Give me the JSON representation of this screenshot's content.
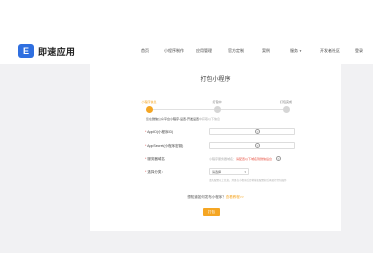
{
  "header": {
    "logo_mark": "E",
    "logo_text": "即速应用",
    "nav": [
      {
        "label": "首页",
        "left": 0
      },
      {
        "label": "小程序制作",
        "left": 0
      },
      {
        "label": "应用管理",
        "left": 0
      },
      {
        "label": "官方定制",
        "left": 0
      },
      {
        "label": "案例",
        "left": 0
      },
      {
        "label": "服务",
        "left": 0,
        "has_dropdown": true
      },
      {
        "label": "开发者社区",
        "left": 0
      },
      {
        "label": "登录",
        "left": 0
      }
    ]
  },
  "card": {
    "title": "打包小程序",
    "steps": [
      {
        "label": "小程序信息",
        "active": true
      },
      {
        "label": "打包中",
        "active": false
      },
      {
        "label": "打包完成",
        "active": false
      }
    ],
    "hint_prefix": "您在",
    "hint_highlight": "微信公众平台小程序-设置-开发设置",
    "hint_suffix": "中获取以下信息",
    "fields": [
      {
        "label": "AppID(小程序ID)",
        "value": "",
        "help": "?"
      },
      {
        "label": "AppSecret(小程序密钥)",
        "value": "",
        "help": "?"
      }
    ],
    "upload": {
      "label": "服务器域名",
      "tip_prefix": "小程序服务器域名：",
      "tip_red": "请配置以下域名到微信后台",
      "help": "?"
    },
    "select": {
      "label": "选择分类：",
      "value": "请选择",
      "caret": "▾"
    },
    "note": "请先配置以上信息，并且在小程序后台将域名配置好后再进行打包操作",
    "mini_link_prefix": "想知道如何发布小程序？",
    "mini_link_orange": "查看教程>>",
    "submit_label": "打包"
  }
}
